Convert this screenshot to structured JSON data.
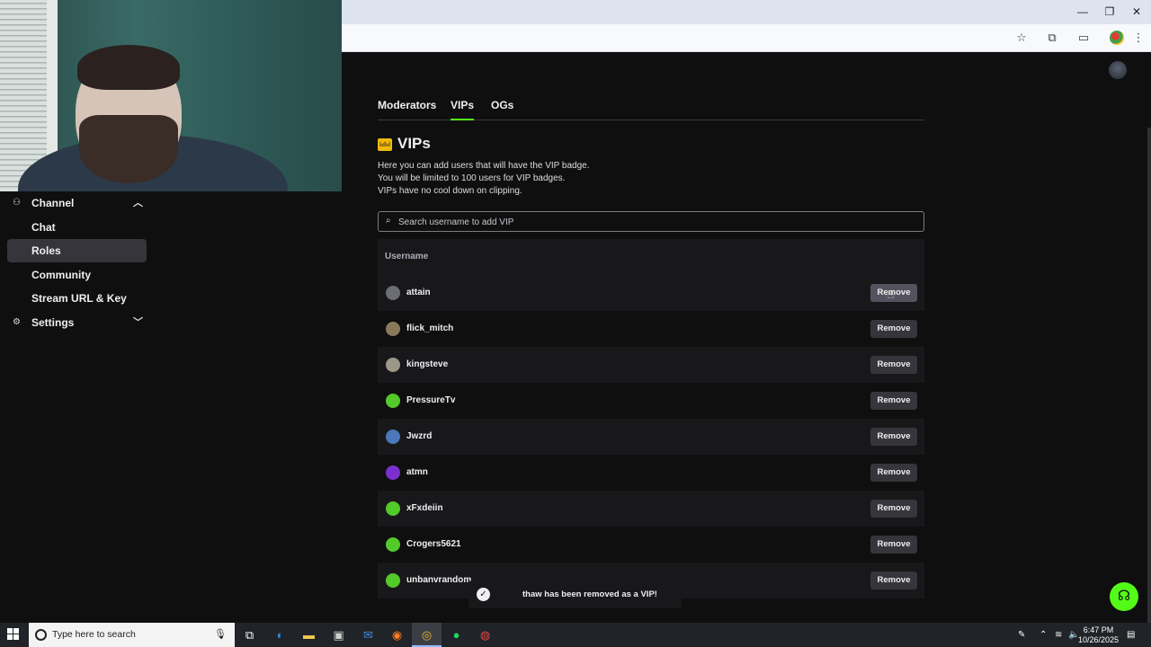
{
  "browser": {
    "window_controls": {
      "minimize": "—",
      "restore": "❐",
      "close": "✕"
    },
    "toolbar_icons": [
      "star-icon",
      "extensions-icon",
      "cast-icon",
      "profile-avatar",
      "menu-icon"
    ]
  },
  "sidebar": {
    "items": [
      {
        "label": "Channel",
        "icon": "channel-icon",
        "chevron": "up",
        "active": false
      },
      {
        "label": "Chat",
        "active": false
      },
      {
        "label": "Roles",
        "active": true
      },
      {
        "label": "Community",
        "active": false
      },
      {
        "label": "Stream URL & Key",
        "active": false
      },
      {
        "label": "Settings",
        "icon": "gear-icon",
        "chevron": "down",
        "active": false
      }
    ]
  },
  "main": {
    "tabs": [
      {
        "label": "Moderators",
        "active": false
      },
      {
        "label": "VIPs",
        "active": true
      },
      {
        "label": "OGs",
        "active": false
      }
    ],
    "heading": "VIPs",
    "description": [
      "Here you can add users that will have the VIP badge.",
      "You will be limited to 100 users for VIP badges.",
      "VIPs have no cool down on clipping."
    ],
    "search": {
      "placeholder": "Search username to add VIP",
      "value": ""
    },
    "table": {
      "column_header": "Username",
      "remove_label": "Remove",
      "rows": [
        {
          "username": "attain",
          "avatar_color": "#6b6e73"
        },
        {
          "username": "flick_mitch",
          "avatar_color": "#8a7a5c"
        },
        {
          "username": "kingsteve",
          "avatar_color": "#9c9888"
        },
        {
          "username": "PressureTv",
          "avatar_color": "#53c92a"
        },
        {
          "username": "Jwzrd",
          "avatar_color": "#4a78b8"
        },
        {
          "username": "atmn",
          "avatar_color": "#7b2fd0"
        },
        {
          "username": "xFxdeiin",
          "avatar_color": "#53c92a"
        },
        {
          "username": "Crogers5621",
          "avatar_color": "#53c92a"
        },
        {
          "username": "unbanvrandom",
          "avatar_color": "#53c92a"
        }
      ]
    },
    "toast": "thaw has been removed as a VIP!"
  },
  "taskbar": {
    "search_placeholder": "Type here to search",
    "time": "6:47 PM",
    "date": "10/26/2025"
  },
  "colors": {
    "accent": "#53fc18",
    "background": "#0f0f10",
    "row_alt": "#18181b",
    "button": "#35353b",
    "crown": "#f0b90b"
  }
}
